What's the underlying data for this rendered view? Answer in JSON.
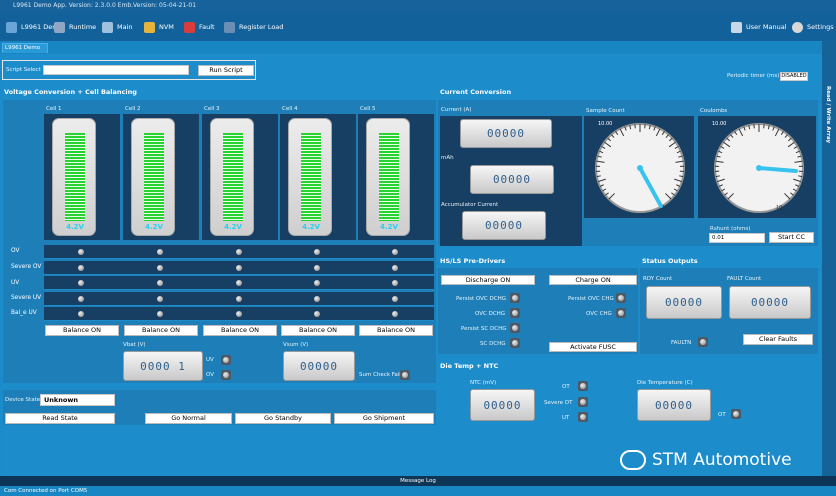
{
  "window_title": "L9961 Demo App. Version: 2.3.0.0 Emb.Version: 05-04-21-01",
  "toolbar": {
    "demo": "L9961 Demo",
    "runtime": "Runtime",
    "main": "Main",
    "nvm": "NVM",
    "fault": "Fault",
    "register_load": "Register Load",
    "user_manual": "User Manual",
    "settings": "Settings"
  },
  "tab": "L9961 Demo",
  "script": {
    "label": "Script Select",
    "button": "Run Script"
  },
  "periodic": {
    "label": "Periodic timer (ms)",
    "value": "DISABLED"
  },
  "side_tab": "Read / Write Array",
  "voltage": {
    "title": "Voltage Conversion + Cell Balancing",
    "cells": [
      {
        "name": "Cell 1",
        "v": "4.2V",
        "btn": "Balance ON"
      },
      {
        "name": "Cell 2",
        "v": "4.2V",
        "btn": "Balance ON"
      },
      {
        "name": "Cell 3",
        "v": "4.2V",
        "btn": "Balance ON"
      },
      {
        "name": "Cell 4",
        "v": "4.2V",
        "btn": "Balance ON"
      },
      {
        "name": "Cell 5",
        "v": "4.2V",
        "btn": "Balance ON"
      }
    ],
    "rows": [
      "OV",
      "Severe OV",
      "UV",
      "Severe UV",
      "Bal_e UV"
    ],
    "vbat_label": "Vbat (V)",
    "vbat_val": "0000 1",
    "uv": "UV",
    "ov": "OV",
    "vsum_label": "Vsum (V)",
    "vsum_val": "00000",
    "sum_check": "Sum Check Fail"
  },
  "device": {
    "label": "Device State",
    "value": "Unknown",
    "read": "Read State",
    "normal": "Go Normal",
    "standby": "Go Standby",
    "shipment": "Go Shipment"
  },
  "current": {
    "title": "Current Conversion",
    "current_label": "Current (A)",
    "mah": "mAh",
    "acc": "Accumulator Current",
    "d1": "00000",
    "d2": "00000",
    "d3": "00000",
    "sample_count": "Sample Count",
    "coulombs": "Coulombs",
    "g_min": "0.00",
    "g_max": "10.00",
    "g1_tick": "10",
    "g2_tick": "10",
    "rshunt_label": "Rshunt (ohms)",
    "rshunt_val": "0.01",
    "start": "Start CC"
  },
  "hsls": {
    "title": "HS/LS Pre-Drivers",
    "dis": "Discharge ON",
    "chg": "Charge ON",
    "p1": "Persist OVC DCHG",
    "p2": "OVC DCHG",
    "p3": "Persist SC DCHG",
    "p4": "SC DCHG",
    "q1": "Persist OVC CHG",
    "q2": "OVC CHG",
    "fusc": "Activate FUSC"
  },
  "status": {
    "title": "Status Outputs",
    "rdy": "RDY Count",
    "fault": "FAULT Count",
    "d1": "00000",
    "d2": "00000",
    "faultn": "FAULTN",
    "clear": "Clear Faults"
  },
  "die": {
    "title": "Die Temp + NTC",
    "ntc": "NTC (mV)",
    "d1": "00000",
    "ot": "OT",
    "sev_ot": "Severe OT",
    "ut": "UT",
    "dt": "Die Temperature (C)",
    "d2": "00000",
    "ot2": "OT"
  },
  "msg": "Message Log",
  "status_bar": "Com Connected on Port COM5",
  "watermark": "STM Automotive"
}
